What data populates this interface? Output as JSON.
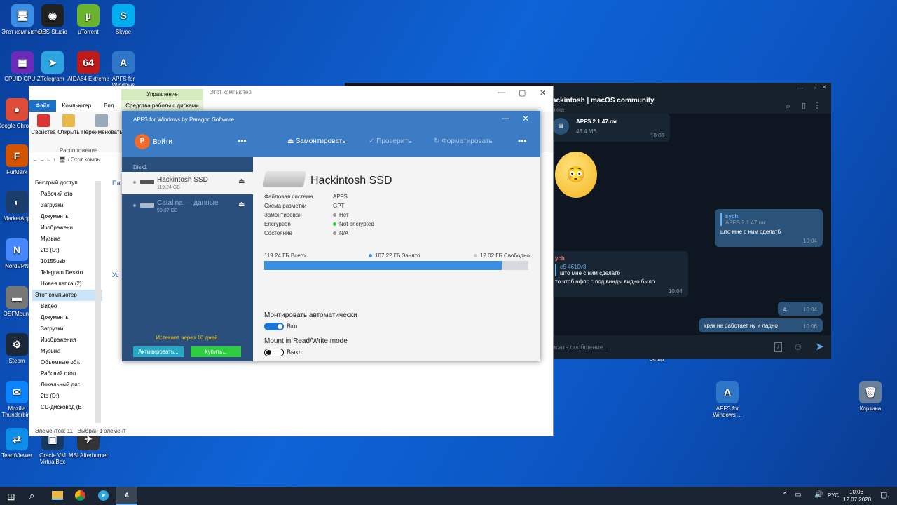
{
  "desktop_icons": [
    {
      "name": "this-pc",
      "label": "Этот компьютер",
      "glyph": "🖥",
      "color": "#3a8ee6"
    },
    {
      "name": "obs",
      "label": "OBS Studio",
      "glyph": "◉",
      "color": "#222"
    },
    {
      "name": "utorrent",
      "label": "µTorrent",
      "glyph": "µ",
      "color": "#6ab42d"
    },
    {
      "name": "skype",
      "label": "Skype",
      "glyph": "S",
      "color": "#00aff0"
    },
    {
      "name": "cpuz",
      "label": "CPUID CPU-Z",
      "glyph": "▦",
      "color": "#6b2bb8"
    },
    {
      "name": "telegram",
      "label": "Telegram",
      "glyph": "➤",
      "color": "#2ca5e0"
    },
    {
      "name": "aida64",
      "label": "AIDA64 Extreme",
      "glyph": "64",
      "color": "#c0191a"
    },
    {
      "name": "apfs",
      "label": "APFS for Windows",
      "glyph": "A",
      "color": "#2f76c8"
    },
    {
      "name": "chrome",
      "label": "Google Chrome",
      "glyph": "●",
      "color": "#dd4b39"
    },
    {
      "name": "furmark",
      "label": "FurMark",
      "glyph": "F",
      "color": "#d35400"
    },
    {
      "name": "marketapp",
      "label": "MarketApp",
      "glyph": "◐",
      "color": "#1a3d6b"
    },
    {
      "name": "nordvpn",
      "label": "NordVPN",
      "glyph": "N",
      "color": "#4687ff"
    },
    {
      "name": "osfmount",
      "label": "OSFMount",
      "glyph": "▬",
      "color": "#777"
    },
    {
      "name": "steam",
      "label": "Steam",
      "glyph": "⚙",
      "color": "#1b2838"
    },
    {
      "name": "thunderbird",
      "label": "Mozilla Thunderbird",
      "glyph": "✉",
      "color": "#0a84ff"
    },
    {
      "name": "teamviewer",
      "label": "TeamViewer",
      "glyph": "⇄",
      "color": "#0e8ee9"
    },
    {
      "name": "virtualbox",
      "label": "Oracle VM VirtualBox",
      "glyph": "▣",
      "color": "#183a61"
    },
    {
      "name": "afterburner",
      "label": "MSI Afterburner",
      "glyph": "✈",
      "color": "#333"
    },
    {
      "name": "apfs2",
      "label": "APFS for Windows ...",
      "glyph": "A",
      "color": "#2f76c8"
    },
    {
      "name": "recycle",
      "label": "Корзина",
      "glyph": "🗑",
      "color": "#6a7f99"
    },
    {
      "name": "setup",
      "label": "Setup",
      "glyph": "",
      "color": "transparent"
    }
  ],
  "explorer": {
    "title": "Этот компьютер",
    "context_group": "Управление",
    "context_tab": "Средства работы с дисками",
    "tabs": [
      "Файл",
      "Компьютер",
      "Вид"
    ],
    "ribbon": [
      "Свойства",
      "Открыть",
      "Переименовать"
    ],
    "ribbon_group": "Расположение",
    "address": "Этот компь",
    "nav": [
      "Быстрый доступ",
      "Рабочий сто",
      "Загрузки",
      "Документы",
      "Изображени",
      "Музыка",
      "2tb (D:)",
      "10155usb",
      "Telegram Deskto",
      "Новая папка (2)",
      "Этот компьютер",
      "Видео",
      "Документы",
      "Загрузки",
      "Изображения",
      "Музыка",
      "Объемные объ",
      "Рабочий стол",
      "Локальный дис",
      "2tb (D:)",
      "CD-дисковод (E"
    ],
    "status_items": "Элементов: 11",
    "status_sel": "Выбран 1 элемент",
    "side_a": "Па",
    "side_b": "Ус"
  },
  "telegram": {
    "title": "ackintosh | macOS community",
    "subtitle": "ника",
    "file_name": "APFS.2.1.47.rar",
    "file_size": "43.4 MB",
    "file_time": "10:03",
    "reply_author": "sych",
    "reply_quote": "APFS.2.1.47.rar",
    "reply_text": "што мне с ним сделатб",
    "reply_time": "10:04",
    "in_author": "ych",
    "in_quote_author": "e5 4610v3",
    "in_quote_text": "што мне с ним сделатб",
    "in_text": "то чтоб афпс с под винды видно было",
    "in_time": "10:04",
    "a_text": "а",
    "a_time": "10:04",
    "last_text": "кряк не работает ну и ладно",
    "last_time": "10:06",
    "input_placeholder": "исать сообщение..."
  },
  "apfs": {
    "app_title": "APFS for Windows by Paragon Software",
    "login": "Войти",
    "mount": "Замонтировать",
    "check": "Проверить",
    "format": "Форматировать",
    "disk_label": "Disk1",
    "disks": [
      {
        "name": "Hackintosh SSD",
        "size": "119.24 GB"
      },
      {
        "name": "Catalina — данные",
        "size": "59.37 GB"
      }
    ],
    "trial": "Истекает через 10 дней.",
    "activate": "Активировать...",
    "buy": "Купить...",
    "volume_title": "Hackintosh SSD",
    "props": [
      {
        "k": "Файловая система",
        "v": "APFS",
        "dot": ""
      },
      {
        "k": "Схема разметки",
        "v": "GPT",
        "dot": ""
      },
      {
        "k": "Замонтирован",
        "v": "Нет",
        "dot": "#9a9a9a"
      },
      {
        "k": "Encryption",
        "v": "Not encrypted",
        "dot": "#2ecc40"
      },
      {
        "k": "Состояние",
        "v": "N/A",
        "dot": "#9a9a9a"
      }
    ],
    "total": "119.24 ГБ Всего",
    "used": "107.22 ГБ Занято",
    "free": "12.02 ГБ Свободно",
    "used_fraction": 0.899,
    "automount_label": "Монтировать автоматически",
    "automount_state": "Вкл",
    "rw_label": "Mount in Read/Write mode",
    "rw_state": "Выкл"
  },
  "taskbar": {
    "lang": "РУС",
    "time": "10:06",
    "date": "12.07.2020",
    "notif": "1"
  }
}
